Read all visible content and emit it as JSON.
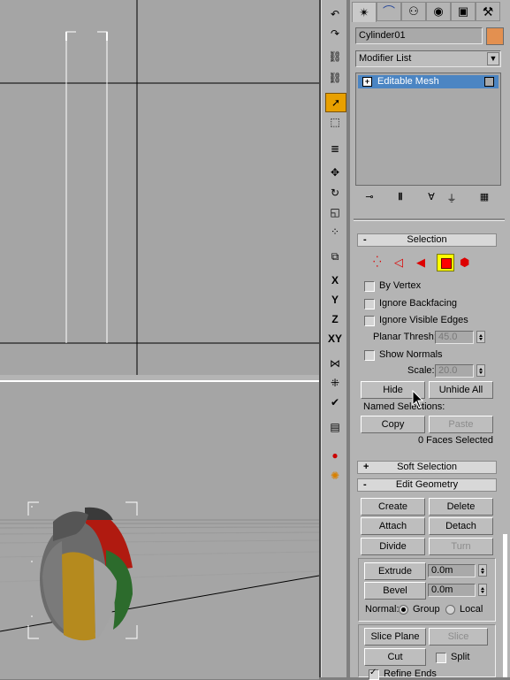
{
  "object_name": "Cylinder01",
  "object_color": "#e39050",
  "modifier_list": "Modifier List",
  "stack_item": "Editable Mesh",
  "stack_expand": "+",
  "toolbar_axes": [
    "X",
    "Y",
    "Z",
    "XY"
  ],
  "selection": {
    "header": "Selection",
    "collapse_sign": "-",
    "by_vertex": "By Vertex",
    "ignore_backfacing": "Ignore Backfacing",
    "ignore_visible_edges": "Ignore Visible Edges",
    "planar_thresh_label": "Planar Thresh:",
    "planar_thresh_value": "45.0",
    "show_normals": "Show Normals",
    "scale_label": "Scale:",
    "scale_value": "20.0",
    "hide": "Hide",
    "unhide_all": "Unhide All",
    "named_selections": "Named Selections:",
    "copy": "Copy",
    "paste": "Paste",
    "status": "0 Faces Selected"
  },
  "soft_selection": {
    "header": "Soft Selection",
    "sign": "+"
  },
  "edit_geometry": {
    "header": "Edit Geometry",
    "sign": "-",
    "create": "Create",
    "delete": "Delete",
    "attach": "Attach",
    "detach": "Detach",
    "divide": "Divide",
    "turn": "Turn",
    "extrude": "Extrude",
    "extrude_value": "0.0m",
    "bevel": "Bevel",
    "bevel_value": "0.0m",
    "normal_label": "Normal:",
    "group": "Group",
    "local": "Local",
    "slice_plane": "Slice Plane",
    "slice": "Slice",
    "cut": "Cut",
    "split": "Split",
    "refine_ends": "Refine Ends"
  },
  "colors": {
    "viewport": "#a5a5a5",
    "panel": "#b4b4b4",
    "accent": "#e8a000",
    "stack_highlight": "#4b85c3",
    "face_mode": "#ff0000"
  }
}
